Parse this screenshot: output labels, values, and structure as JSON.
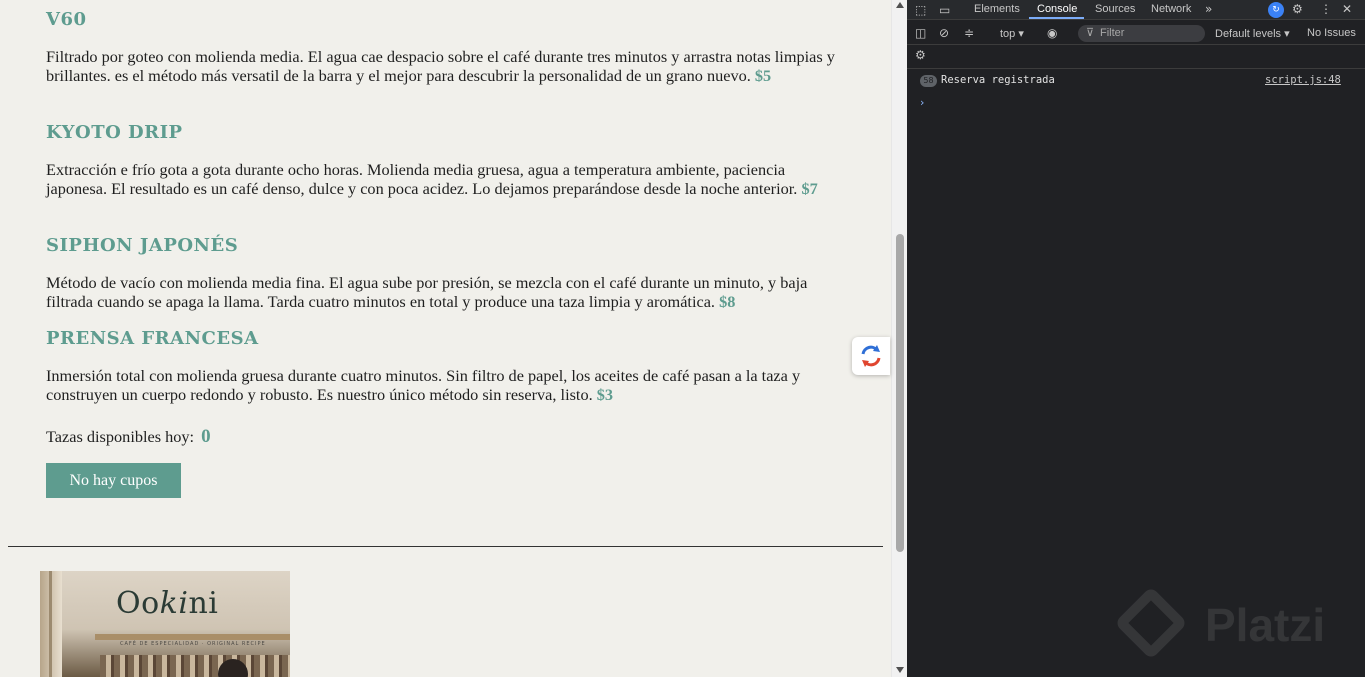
{
  "menu": {
    "methods": [
      {
        "title": "V60",
        "description": "Filtrado por goteo con molienda media. El agua cae despacio sobre el café durante tres minutos y arrastra notas limpias y brillantes. es el método más versatil de la barra y el mejor para descubrir la personalidad de un grano nuevo.",
        "price": "$5"
      },
      {
        "title": "KYOTO DRIP",
        "description": "Extracción e frío gota a gota durante ocho horas. Molienda media gruesa, agua a temperatura ambiente, paciencia japonesa. El resultado es un café denso, dulce y con poca acidez. Lo dejamos preparándose desde la noche anterior.",
        "price": "$7"
      },
      {
        "title": "SIPHON JAPONÉS",
        "description": "Método de vacío con molienda media fina. El agua sube por presión, se mezcla con el café durante un minuto, y baja filtrada cuando se apaga la llama. Tarda cuatro minutos en total y produce una taza limpia y aromática.",
        "price": "$8"
      },
      {
        "title": "PRENSA FRANCESA",
        "description": "Inmersión total con molienda gruesa durante cuatro minutos. Sin filtro de papel, los aceites de café pasan a la taza y construyen un cuerpo redondo y robusto. Es nuestro único método sin reserva, listo.",
        "price": "$3"
      }
    ],
    "availability_label": "Tazas disponibles hoy:",
    "availability_count": "0",
    "reserve_button": "No hay cupos"
  },
  "photo": {
    "logo_text_pre": "Oo",
    "logo_text_italic": "ki",
    "logo_text_post": "ni",
    "tagline": "CAFÉ DE ESPECIALIDAD · ORIGINAL RECIPE"
  },
  "devtools": {
    "tabs": [
      "Elements",
      "Console",
      "Sources",
      "Network"
    ],
    "active_tab": "Console",
    "context": "top ▾",
    "filter_placeholder": "Filter",
    "levels": "Default levels ▾",
    "issues": "No Issues",
    "messages": [
      {
        "count": "58",
        "text": "Reserva registrada",
        "source": "script.js:48"
      }
    ],
    "prompt": "›"
  },
  "watermark": "Platzi",
  "colors": {
    "accent": "#5e9c8f",
    "page_bg": "#f1f0eb",
    "devtools_bg": "#202124"
  }
}
